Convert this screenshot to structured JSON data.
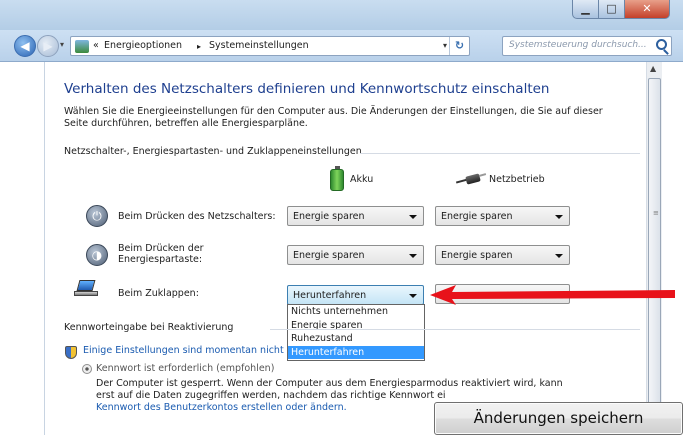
{
  "window": {
    "minimize_glyph": "▁",
    "maximize_glyph": "□",
    "close_glyph": "✕"
  },
  "nav": {
    "back_glyph": "◀",
    "forward_glyph": "▶",
    "history_glyph": "▾",
    "breadcrumb_overflow": "«",
    "breadcrumbs": [
      "Energieoptionen",
      "Systemeinstellungen"
    ],
    "breadcrumb_separator": "▸",
    "address_dropdown_glyph": "▾",
    "refresh_glyph": "↻",
    "search_placeholder": "Systemsteuerung durchsuch..."
  },
  "page": {
    "heading": "Verhalten des Netzschalters definieren und Kennwortschutz einschalten",
    "intro": "Wählen Sie die Energieeinstellungen für den Computer aus. Die Änderungen der Einstellungen, die Sie auf dieser Seite durchführen, betreffen alle Energiesparpläne.",
    "section_buttons": "Netzschalter-, Energiespartasten- und Zuklappeneinstellungen",
    "col_battery": "Akku",
    "col_ac": "Netzbetrieb",
    "rows": [
      {
        "label": "Beim Drücken des Netzschalters:",
        "battery": "Energie sparen",
        "ac": "Energie sparen"
      },
      {
        "label_line1": "Beim Drücken der",
        "label_line2": "Energiespartaste:",
        "battery": "Energie sparen",
        "ac": "Energie sparen"
      },
      {
        "label": "Beim Zuklappen:",
        "battery": "Herunterfahren"
      }
    ],
    "dropdown_options": [
      "Nichts unternehmen",
      "Energie sparen",
      "Ruhezustand",
      "Herunterfahren"
    ],
    "dropdown_selected_index": 3,
    "section_password": "Kennworteingabe bei Reaktivierung",
    "admin_link": "Einige Einstellungen sind momentan nicht",
    "radio_label": "Kennwort ist erforderlich (empfohlen)",
    "desc_line1": "Der Computer ist gesperrt. Wenn der Computer aus dem Energiesparmodus reaktiviert wird, kann",
    "desc_line2": "erst auf die Daten zugegriffen werden, nachdem das richtige Kennwort ei",
    "desc_line3": "Kennwort des Benutzerkontos erstellen oder ändern."
  },
  "save_button": "Änderungen speichern",
  "colors": {
    "heading": "#1e3f8f",
    "link": "#1a5bb0",
    "selection": "#3399ff",
    "arrow": "#e8121a"
  }
}
